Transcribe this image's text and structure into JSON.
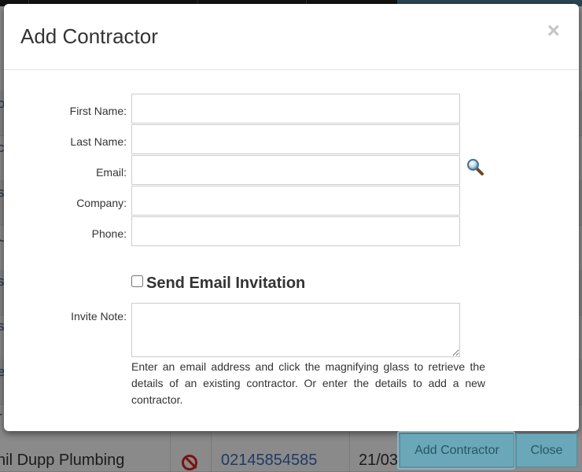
{
  "background": {
    "row": {
      "company": "nil Dupp Plumbing",
      "phone": "02145854585",
      "date": "21/03"
    },
    "edge_glyphs": [
      "o",
      "c",
      "s",
      "U",
      "s",
      "s",
      "e",
      "r"
    ]
  },
  "modal": {
    "title": "Add Contractor",
    "close_glyph": "×",
    "fields": {
      "first_name_label": "First Name:",
      "last_name_label": "Last Name:",
      "email_label": "Email:",
      "company_label": "Company:",
      "phone_label": "Phone:",
      "first_name_value": "",
      "last_name_value": "",
      "email_value": "",
      "company_value": "",
      "phone_value": ""
    },
    "send_invite_label": "Send Email Invitation",
    "send_invite_checked": false,
    "invite_note_label": "Invite Note:",
    "invite_note_value": "",
    "help_text": "Enter an email address and click the magnifying glass to retrieve the details of an existing contractor. Or enter the details to add a new contractor.",
    "icons": {
      "search": "magnifying-glass-icon",
      "close": "close-icon"
    }
  },
  "footer": {
    "add_button_label": "Add Contractor",
    "close_button_label": "Close"
  },
  "colors": {
    "accent_button": "#6aa7b8",
    "overlay": "#7b7b7b"
  }
}
